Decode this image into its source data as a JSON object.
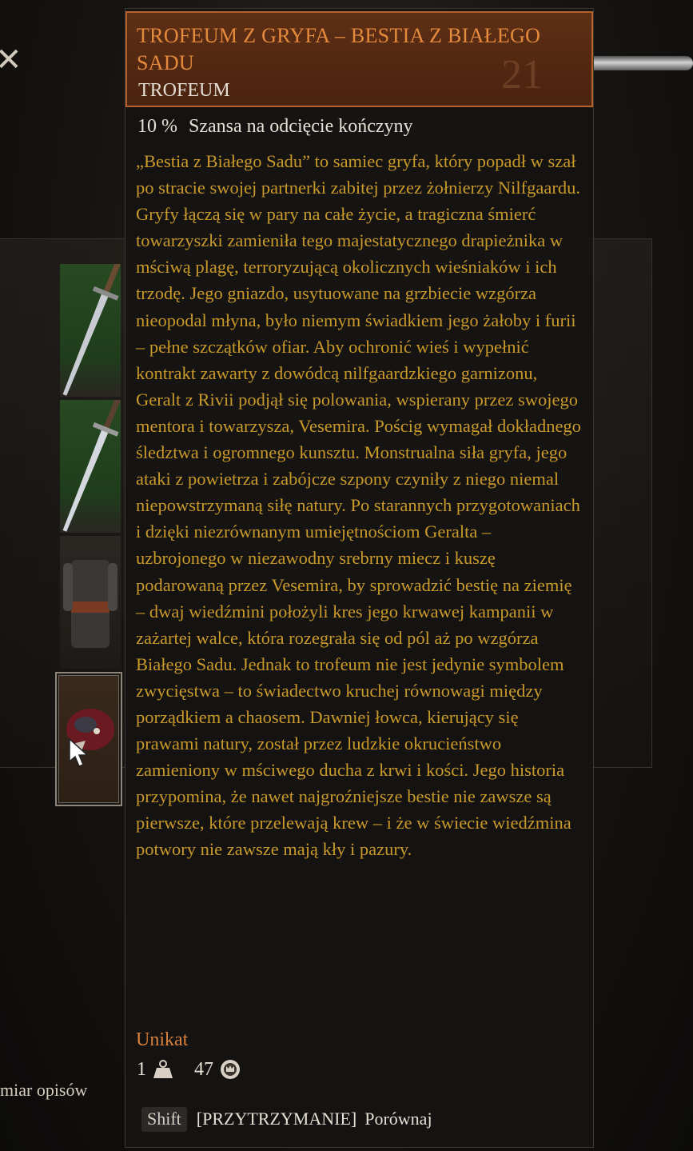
{
  "background": {
    "close_glyph": "✕",
    "bottom_left_text": "miar opisów"
  },
  "tooltip": {
    "title": "TROFEUM Z GRYFA – BESTIA Z BIAŁEGO SADU",
    "type": "TROFEUM",
    "level": "21",
    "stat": {
      "value": "10 %",
      "label": "Szansa na odcięcie kończyny"
    },
    "description": "„Bestia z Białego Sadu” to samiec gryfa, który popadł w szał po stracie swojej partnerki zabitej przez żołnierzy Nilfgaardu. Gryfy łączą się w pary na całe życie, a tragiczna śmierć towarzyszki zamieniła tego majestatycznego drapieżnika w mściwą plagę, terroryzującą okolicznych wieśniaków i ich trzodę. Jego gniazdo, usytuowane na grzbiecie wzgórza nieopodal młyna, było niemym świadkiem jego żałoby i furii – pełne szczątków ofiar. Aby ochronić wieś i wypełnić kontrakt zawarty z dowódcą nilfgaardzkiego garnizonu, Geralt z Rivii podjął się polowania, wspierany przez swojego mentora i towarzysza, Vesemira. Pościg wymagał dokładnego śledztwa i ogromnego kunsztu. Monstrualna siła gryfa, jego ataki z powietrza i zabójcze szpony czyniły z niego niemal niepowstrzymaną siłę natury. Po starannych przygotowaniach i dzięki niezrównanym umiejętnościom Geralta – uzbrojonego w niezawodny srebrny miecz i kuszę podarowaną przez Vesemira, by sprowadzić bestię na ziemię – dwaj wiedźmini położyli kres jego krwawej kampanii w zażartej walce, która rozegrała się od pól aż po wzgórza Białego Sadu. Jednak to trofeum nie jest jedynie symbolem zwycięstwa – to świadectwo kruchej równowagi między porządkiem a chaosem. Dawniej łowca, kierujący się prawami natury, został przez ludzkie okrucieństwo zamieniony w mściwego ducha z krwi i kości. Jego historia przypomina, że nawet najgroźniejsze bestie nie zawsze są pierwsze, które przelewają krew – i że w świecie wiedźmina potwory nie zawsze mają kły i pazury.",
    "rarity": "Unikat",
    "weight": "1",
    "weight_icon": "weight-icon",
    "price": "47",
    "price_icon": "crowns-coin-icon",
    "footer": {
      "key": "Shift",
      "hold_label": "[PRZYTRZYMANIE]",
      "action": "Porównaj"
    }
  },
  "colors": {
    "header_bg": "#5d2f15",
    "header_border": "#b7622a",
    "title": "#e58a3c",
    "description": "#c9992a",
    "rarity": "#d9803a"
  }
}
